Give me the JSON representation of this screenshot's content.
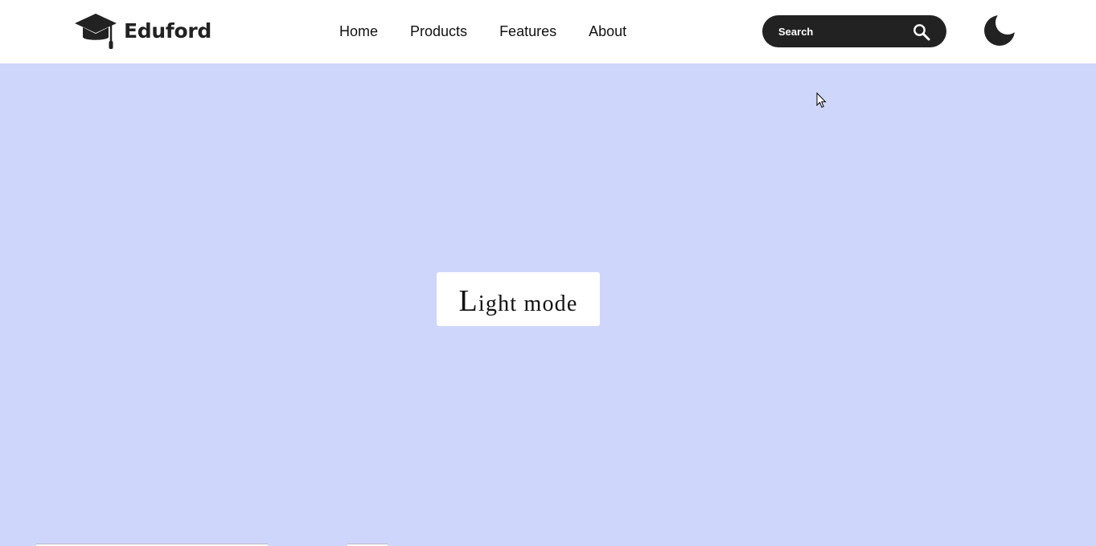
{
  "brand": {
    "name": "Eduford",
    "icon": "graduation-cap-icon"
  },
  "nav": {
    "links": [
      {
        "label": "Home"
      },
      {
        "label": "Products"
      },
      {
        "label": "Features"
      },
      {
        "label": "About"
      }
    ]
  },
  "search": {
    "placeholder": "Search",
    "value": "",
    "icon": "search-icon"
  },
  "theme_toggle": {
    "icon": "moon-icon"
  },
  "main": {
    "mode_label": "Light mode"
  },
  "colors": {
    "navbar_bg": "#ffffff",
    "page_bg": "#cfd6fb",
    "search_bg": "#222222",
    "text_dark": "#222222"
  }
}
